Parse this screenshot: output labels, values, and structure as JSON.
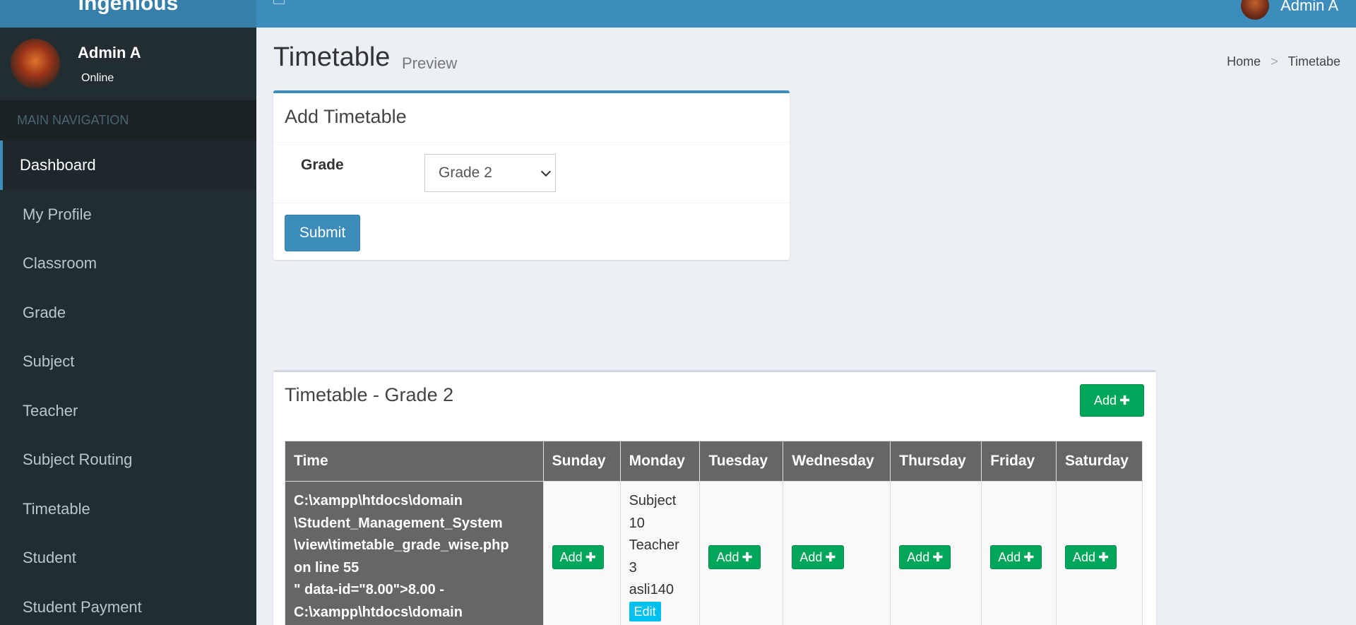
{
  "app": {
    "logo": "Ingenious"
  },
  "header": {
    "user_name": "Admin A"
  },
  "sidebar": {
    "user": {
      "name": "Admin A",
      "status": "Online"
    },
    "section_header": "MAIN NAVIGATION",
    "items": [
      {
        "label": "Dashboard"
      },
      {
        "label": "My Profile"
      },
      {
        "label": "Classroom"
      },
      {
        "label": "Grade"
      },
      {
        "label": "Subject"
      },
      {
        "label": "Teacher"
      },
      {
        "label": "Subject Routing"
      },
      {
        "label": "Timetable"
      },
      {
        "label": "Student"
      },
      {
        "label": "Student Payment"
      }
    ]
  },
  "page": {
    "title": "Timetable",
    "subtitle": "Preview",
    "breadcrumb": {
      "home": "Home",
      "separator": ">",
      "current": "Timetabe"
    }
  },
  "add_form": {
    "title": "Add Timetable",
    "grade_label": "Grade",
    "grade_value": "Grade 2",
    "submit_label": "Submit"
  },
  "timetable": {
    "title": "Timetable - Grade 2",
    "add_label": "Add",
    "columns": [
      "Time",
      "Sunday",
      "Monday",
      "Tuesday",
      "Wednesday",
      "Thursday",
      "Friday",
      "Saturday"
    ],
    "time_cell_lines": [
      "C:\\xampp\\htdocs\\domain",
      "\\Student_Management_System",
      "\\view\\timetable_grade_wise.php",
      "on line 55",
      "\" data-id=\"8.00\">8.00 -",
      "C:\\xampp\\htdocs\\domain"
    ],
    "cell_add_label": "Add",
    "monday": {
      "subject_lines": [
        "Subject",
        "10",
        "Teacher",
        "3",
        "asli140"
      ],
      "edit_label": "Edit"
    }
  },
  "colors": {
    "primary": "#3c8dbc",
    "sidebar": "#222d32",
    "success": "#00a65a",
    "info": "#00c0ef",
    "table_header": "#666666"
  }
}
